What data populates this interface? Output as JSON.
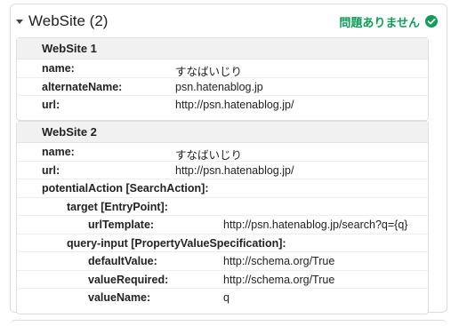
{
  "header": {
    "title": "WebSite (2)",
    "status": "問題ありません",
    "status_color": "#0f9d58"
  },
  "blocks": [
    {
      "title": "WebSite 1",
      "rows": [
        {
          "key": "name:",
          "value": "すなばいじり"
        },
        {
          "key": "alternateName:",
          "value": "psn.hatenablog.jp"
        },
        {
          "key": "url:",
          "value": "http://psn.hatenablog.jp/"
        }
      ]
    },
    {
      "title": "WebSite 2",
      "rows": [
        {
          "key": "name:",
          "value": "すなばいじり"
        },
        {
          "key": "url:",
          "value": "http://psn.hatenablog.jp/"
        },
        {
          "key": "potentialAction [SearchAction]:",
          "value": ""
        },
        {
          "key": "target [EntryPoint]:",
          "value": ""
        },
        {
          "key": "urlTemplate:",
          "value": "http://psn.hatenablog.jp/search?q={q}"
        },
        {
          "key": "query-input [PropertyValueSpecification]:",
          "value": ""
        },
        {
          "key": "defaultValue:",
          "value": "http://schema.org/True"
        },
        {
          "key": "valueRequired:",
          "value": "http://schema.org/True"
        },
        {
          "key": "valueName:",
          "value": "q"
        }
      ]
    }
  ]
}
